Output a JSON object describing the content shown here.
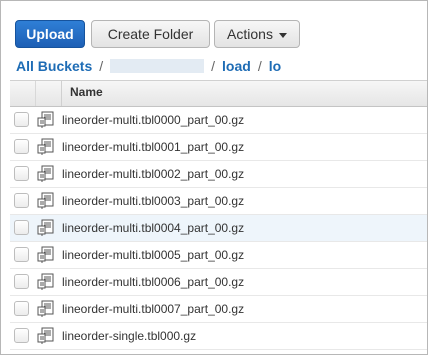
{
  "toolbar": {
    "upload_label": "Upload",
    "create_folder_label": "Create Folder",
    "actions_label": "Actions"
  },
  "breadcrumb": {
    "root": "All Buckets",
    "bucket_redacted": true,
    "path": [
      "load",
      "lo"
    ],
    "separator": "/"
  },
  "table": {
    "name_header": "Name",
    "rows": [
      {
        "name": "lineorder-multi.tbl0000_part_00.gz",
        "icon": "file-icon",
        "hover": false
      },
      {
        "name": "lineorder-multi.tbl0001_part_00.gz",
        "icon": "file-icon",
        "hover": false
      },
      {
        "name": "lineorder-multi.tbl0002_part_00.gz",
        "icon": "file-icon",
        "hover": false
      },
      {
        "name": "lineorder-multi.tbl0003_part_00.gz",
        "icon": "file-icon",
        "hover": false
      },
      {
        "name": "lineorder-multi.tbl0004_part_00.gz",
        "icon": "file-icon",
        "hover": true
      },
      {
        "name": "lineorder-multi.tbl0005_part_00.gz",
        "icon": "file-icon",
        "hover": false
      },
      {
        "name": "lineorder-multi.tbl0006_part_00.gz",
        "icon": "file-icon",
        "hover": false
      },
      {
        "name": "lineorder-multi.tbl0007_part_00.gz",
        "icon": "file-icon",
        "hover": false
      },
      {
        "name": "lineorder-single.tbl000.gz",
        "icon": "file-icon",
        "hover": false
      }
    ]
  },
  "colors": {
    "primary": "#1d5fb5",
    "link": "#1e6cb5",
    "row_hover": "#eef5fb"
  }
}
